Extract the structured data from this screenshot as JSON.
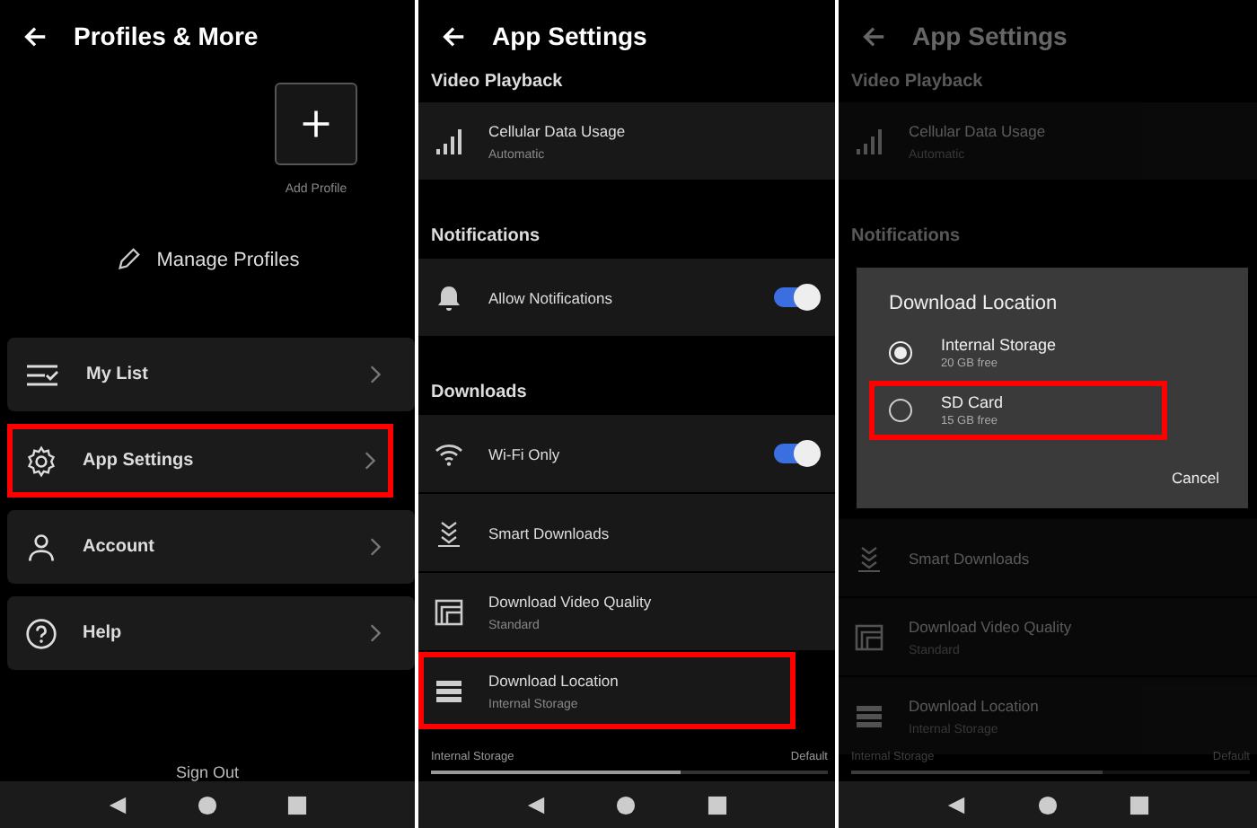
{
  "panels": [
    {
      "kind": "profiles",
      "title": "Profiles & More",
      "add_profile": "Add Profile",
      "manage_profiles": "Manage Profiles",
      "menu": [
        {
          "kind": "list",
          "label": "My List",
          "highlighted": false
        },
        {
          "kind": "settings",
          "label": "App Settings",
          "highlighted": true
        },
        {
          "kind": "account",
          "label": "Account",
          "highlighted": false
        },
        {
          "kind": "help",
          "label": "Help",
          "highlighted": false
        }
      ],
      "sign_out": "Sign Out"
    },
    {
      "kind": "settings",
      "title": "App Settings",
      "dimmed": false,
      "sections": [
        {
          "heading": "Video Playback",
          "rows": [
            {
              "kind": "cellular",
              "label": "Cellular Data Usage",
              "value": "Automatic",
              "highlighted": false
            }
          ]
        },
        {
          "heading": "Notifications",
          "rows": [
            {
              "kind": "notifications",
              "label": "Allow Notifications",
              "on": true,
              "highlighted": false
            }
          ]
        },
        {
          "heading": "Downloads",
          "rows": [
            {
              "kind": "wifi",
              "label": "Wi-Fi Only",
              "on": true,
              "highlighted": false
            },
            {
              "kind": "smart",
              "label": "Smart Downloads",
              "highlighted": false
            },
            {
              "kind": "quality",
              "label": "Download Video Quality",
              "value": "Standard",
              "highlighted": false
            },
            {
              "kind": "location",
              "label": "Download Location",
              "value": "Internal Storage",
              "highlighted": true
            }
          ]
        }
      ],
      "storage": {
        "label": "Internal Storage",
        "value": "Default",
        "level": 0.63
      }
    },
    {
      "kind": "settings",
      "title": "App Settings",
      "dimmed": true,
      "sections": [
        {
          "heading": "Video Playback",
          "rows": [
            {
              "kind": "cellular",
              "label": "Cellular Data Usage",
              "value": "Automatic",
              "highlighted": false
            }
          ]
        },
        {
          "kind": "section",
          "heading": "Notifications"
        },
        {
          "kind": "dialog",
          "title": "Download Location",
          "options": [
            {
              "label": "Internal Storage",
              "detail": "20 GB free",
              "selected": true,
              "highlighted": false
            },
            {
              "label": "SD Card",
              "detail": "15 GB free",
              "selected": false,
              "highlighted": true
            }
          ],
          "cancel": "Cancel"
        },
        {
          "kind": "section",
          "rows": [
            {
              "kind": "smart",
              "label": "Smart Downloads",
              "highlighted": false
            },
            {
              "kind": "quality",
              "label": "Download Video Quality",
              "value": "Standard",
              "highlighted": false
            },
            {
              "kind": "location",
              "label": "Download Location",
              "value": "Internal Storage",
              "highlighted": false
            }
          ]
        }
      ],
      "storage": {
        "label": "Internal Storage",
        "value": "Default",
        "level": 0.63
      }
    }
  ]
}
